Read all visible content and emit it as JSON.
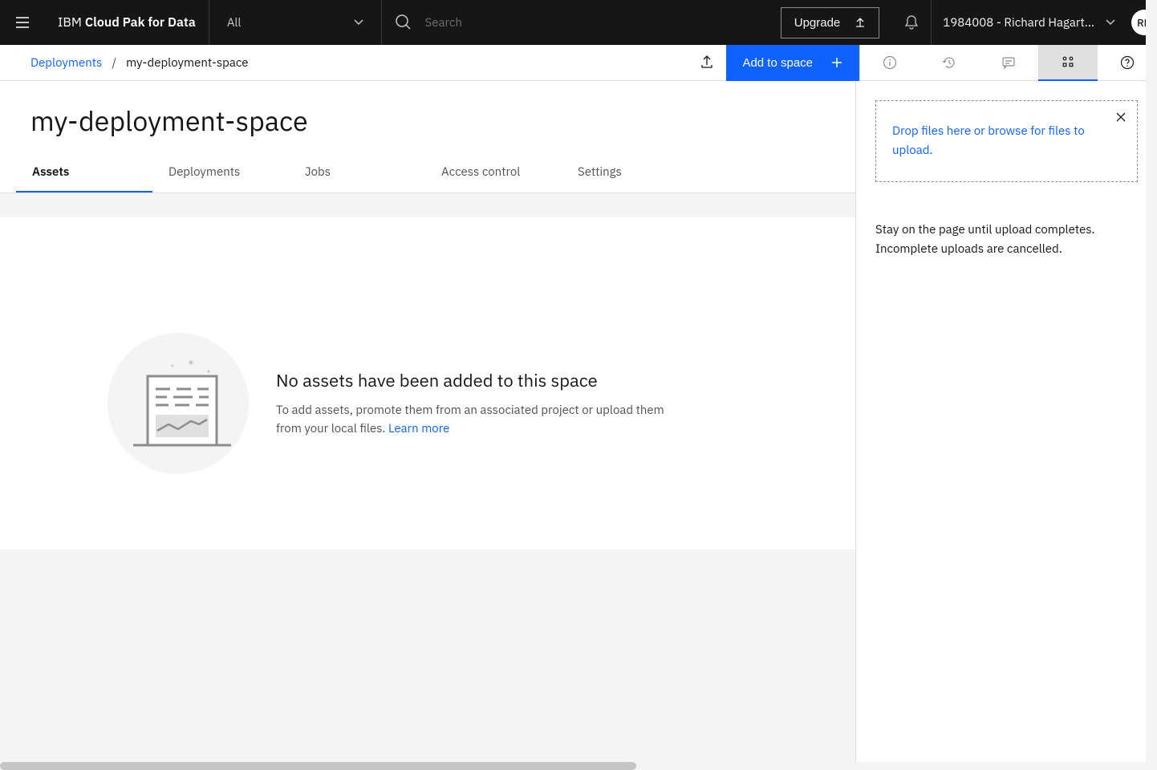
{
  "header": {
    "brand_ibm": "IBM",
    "brand_product": "Cloud Pak for Data",
    "dropdown_label": "All",
    "search_placeholder": "Search",
    "upgrade_label": "Upgrade",
    "user_label": "1984008 - Richard Hagart...",
    "avatar_initials": "RH"
  },
  "breadcrumb": {
    "parent": "Deployments",
    "separator": "/",
    "current": "my-deployment-space"
  },
  "actions": {
    "add_to_space": "Add to space"
  },
  "page": {
    "title": "my-deployment-space"
  },
  "tabs": [
    {
      "label": "Assets",
      "active": true
    },
    {
      "label": "Deployments",
      "active": false
    },
    {
      "label": "Jobs",
      "active": false
    },
    {
      "label": "Access control",
      "active": false
    },
    {
      "label": "Settings",
      "active": false
    }
  ],
  "empty_state": {
    "heading": "No assets have been added to this space",
    "body": "To add assets, promote them from an associated project or upload them from your local files. ",
    "link": "Learn more"
  },
  "side_panel": {
    "drop_text": "Drop files here or browse for files to upload.",
    "help_text": "Stay on the page until upload completes. Incomplete uploads are cancelled."
  }
}
